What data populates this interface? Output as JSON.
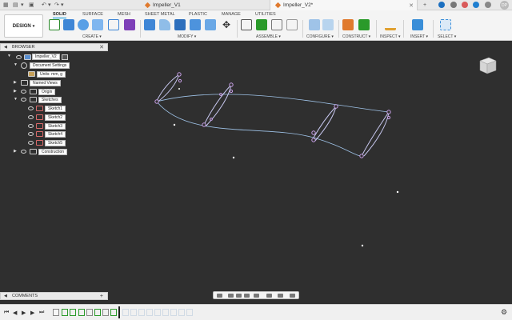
{
  "tabs": [
    {
      "label": "Impeller_V1",
      "active": false
    },
    {
      "label": "Impeller_V2*",
      "active": true
    }
  ],
  "user": {
    "initials": "DP"
  },
  "ribbon": {
    "workspace": "DESIGN",
    "tabs": [
      "SOLID",
      "SURFACE",
      "MESH",
      "SHEET METAL",
      "PLASTIC",
      "MANAGE",
      "UTILITIES"
    ],
    "active_tab": "SOLID",
    "groups": [
      "CREATE",
      "MODIFY",
      "ASSEMBLE",
      "CONFIGURE",
      "CONSTRUCT",
      "INSPECT",
      "INSERT",
      "SELECT"
    ]
  },
  "browser": {
    "title": "BROWSER",
    "items": [
      {
        "label": "Impeller_V2"
      },
      {
        "label": "Document Settings"
      },
      {
        "label": "Units: mm, g"
      },
      {
        "label": "Named Views"
      },
      {
        "label": "Origin"
      },
      {
        "label": "Sketches"
      },
      {
        "label": "Sketch1"
      },
      {
        "label": "Sketch2"
      },
      {
        "label": "Sketch3"
      },
      {
        "label": "Sketch4"
      },
      {
        "label": "Sketch5"
      },
      {
        "label": "Construction"
      }
    ]
  },
  "comments": {
    "title": "COMMENTS"
  },
  "colors": {
    "canvas": "#2f2f2f",
    "sketch_curve": "#9fc3e8",
    "sketch_point": "#c9a0e8",
    "accent": "#0696d7"
  },
  "icons": [
    "undo-icon",
    "redo-icon",
    "save-icon",
    "grid-icon",
    "file-icon",
    "extend-icon",
    "notifications-icon",
    "help-icon",
    "clock-icon",
    "viewcube-icon",
    "settings-icon"
  ]
}
